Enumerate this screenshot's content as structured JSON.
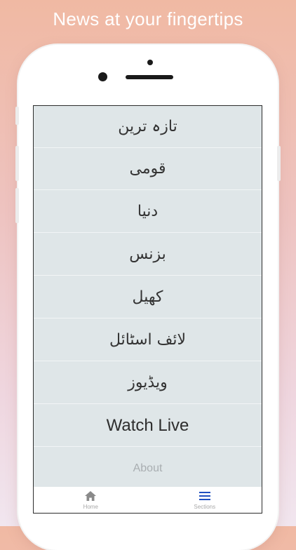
{
  "headline": "News at your fingertips",
  "menu": {
    "items": [
      {
        "label": "تازہ ترین"
      },
      {
        "label": "قومی"
      },
      {
        "label": "دنیا"
      },
      {
        "label": "بزنس"
      },
      {
        "label": "کھیل"
      },
      {
        "label": "لائف اسٹائل"
      },
      {
        "label": "ویڈیوز"
      },
      {
        "label": "Watch Live"
      },
      {
        "label": "About"
      }
    ]
  },
  "tabbar": {
    "home": {
      "label": "Home",
      "icon": "home-icon"
    },
    "sections": {
      "label": "Sections",
      "icon": "hamburger-menu-icon",
      "active": true
    }
  },
  "colors": {
    "screen_bg": "#dfe6e8",
    "active_tab": "#1f4fbf",
    "inactive_tab": "#8a8a8a"
  }
}
